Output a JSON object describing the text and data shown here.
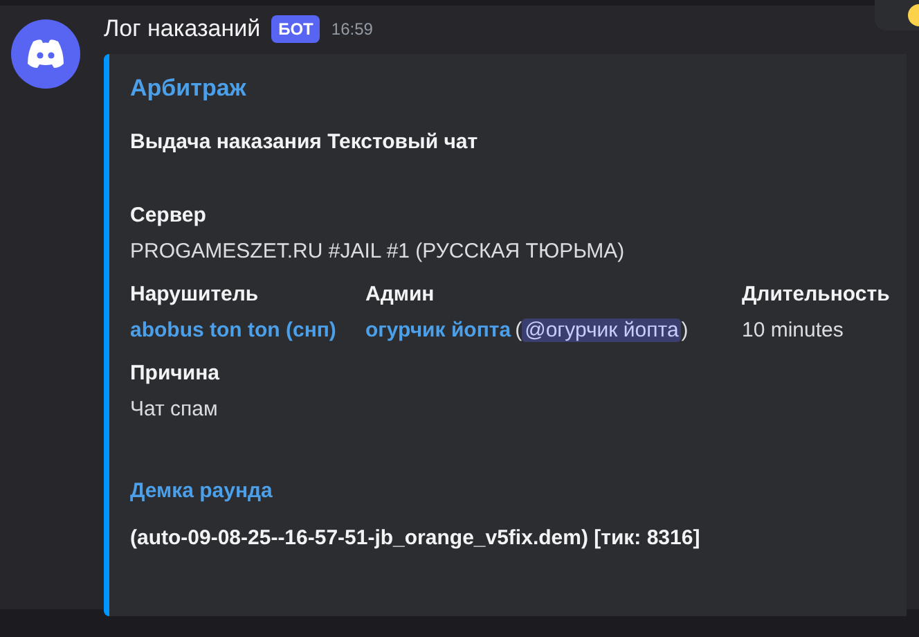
{
  "message": {
    "author": "Лог наказаний",
    "badge": "БОТ",
    "time": "16:59"
  },
  "embed": {
    "title": "Арбитраж",
    "description": "Выдача наказания Текстовый чат",
    "fields": [
      {
        "name": "Сервер",
        "inline": false,
        "segments": [
          {
            "kind": "text",
            "text": "PROGAMESZET.RU #JAIL #1 (РУССКАЯ ТЮРЬМА)"
          }
        ]
      },
      {
        "name": "Нарушитель",
        "inline": true,
        "segments": [
          {
            "kind": "link",
            "text": "abobus ton ton (снп)"
          }
        ]
      },
      {
        "name": "Админ",
        "inline": true,
        "segments": [
          {
            "kind": "link",
            "text": "огурчик йопта"
          },
          {
            "kind": "text",
            "text": "("
          },
          {
            "kind": "mention",
            "text": "@огурчик йопта"
          },
          {
            "kind": "text",
            "text": ")"
          }
        ]
      },
      {
        "name": "Длительность",
        "inline": true,
        "segments": [
          {
            "kind": "text",
            "text": "10 minutes"
          }
        ]
      },
      {
        "name": "Причина",
        "inline": false,
        "segments": [
          {
            "kind": "text",
            "text": "Чат спам"
          }
        ]
      }
    ],
    "link_title": "Демка раунда",
    "footer_text": "(auto-09-08-25--16-57-51-jb_orange_v5fix.dem) [тик: 8316]"
  }
}
